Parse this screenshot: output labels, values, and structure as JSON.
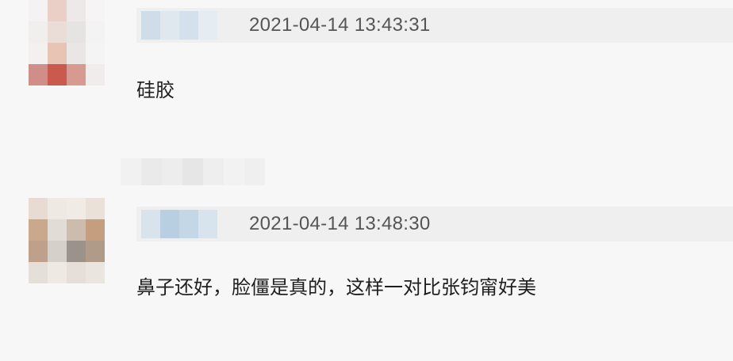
{
  "comments": [
    {
      "timestamp": "2021-04-14 13:43:31",
      "text": "硅胶"
    },
    {
      "timestamp": "2021-04-14 13:48:30",
      "text": "鼻子还好，脸僵是真的，这样一对比张钧甯好美"
    }
  ]
}
